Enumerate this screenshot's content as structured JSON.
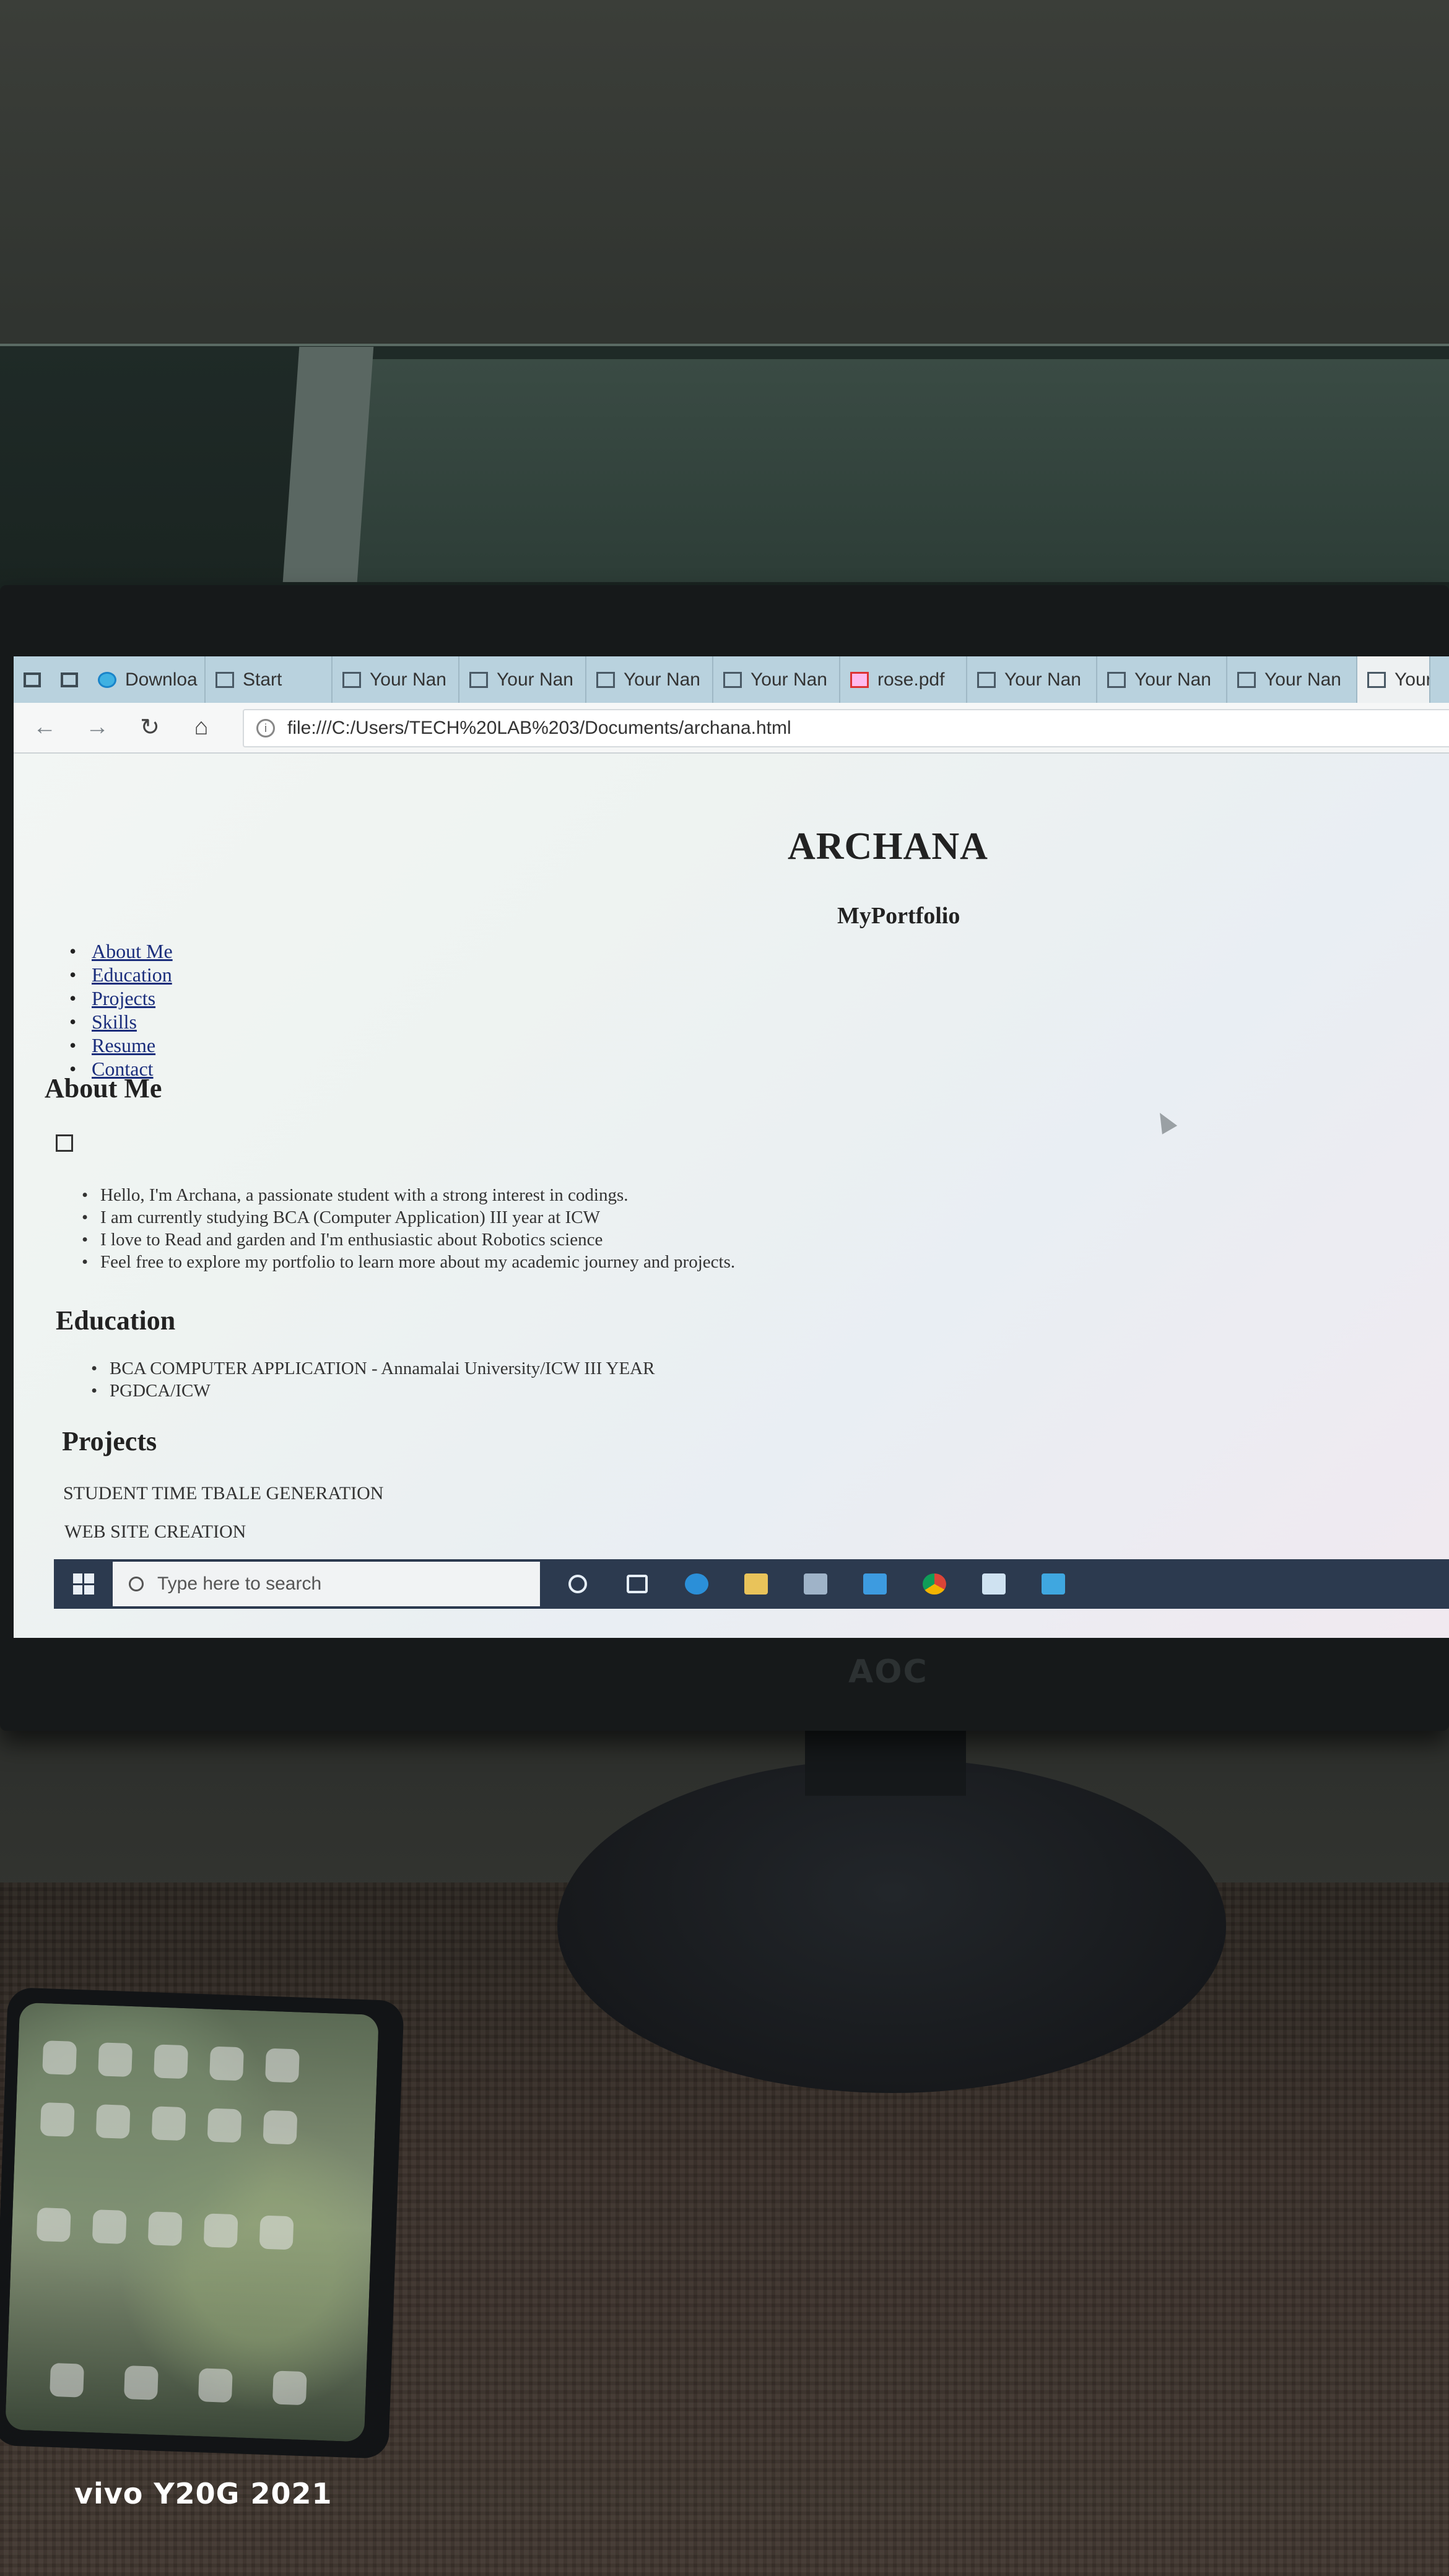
{
  "browser": {
    "tabs": [
      {
        "label": "Downloa",
        "icon": "edge-icon"
      },
      {
        "label": "Start",
        "icon": "page-icon"
      },
      {
        "label": "Your Nan",
        "icon": "page-icon"
      },
      {
        "label": "Your Nan",
        "icon": "page-icon"
      },
      {
        "label": "Your Nan",
        "icon": "page-icon"
      },
      {
        "label": "Your Nan",
        "icon": "page-icon"
      },
      {
        "label": "rose.pdf",
        "icon": "pdf-icon"
      },
      {
        "label": "Your Nan",
        "icon": "page-icon"
      },
      {
        "label": "Your Nan",
        "icon": "page-icon"
      },
      {
        "label": "Your Nan",
        "icon": "page-icon"
      },
      {
        "label": "Your",
        "icon": "page-icon"
      }
    ],
    "url": "file:///C:/Users/TECH%20LAB%203/Documents/archana.html"
  },
  "page": {
    "title": "ARCHANA",
    "subtitle": "MyPortfolio",
    "nav": [
      "About Me",
      "Education",
      "Projects",
      "Skills",
      "Resume",
      "Contact"
    ],
    "about": {
      "heading": "About Me",
      "items": [
        "Hello, I'm Archana, a passionate student with a strong interest in codings.",
        "I am currently studying BCA (Computer Application) III year at ICW",
        "I love to Read and garden and I'm enthusiastic about Robotics science",
        "Feel free to explore my portfolio to learn more about my academic journey and projects."
      ]
    },
    "education": {
      "heading": "Education",
      "items": [
        "BCA COMPUTER APPLICATION - Annamalai University/ICW III YEAR",
        "PGDCA/ICW"
      ]
    },
    "projects": {
      "heading": "Projects",
      "items": [
        "STUDENT TIME TBALE GENERATION",
        "WEB SITE CREATION"
      ]
    }
  },
  "taskbar": {
    "search_placeholder": "Type here to search"
  },
  "monitor_brand": "AOC",
  "watermark": "vivo Y20G 2021"
}
